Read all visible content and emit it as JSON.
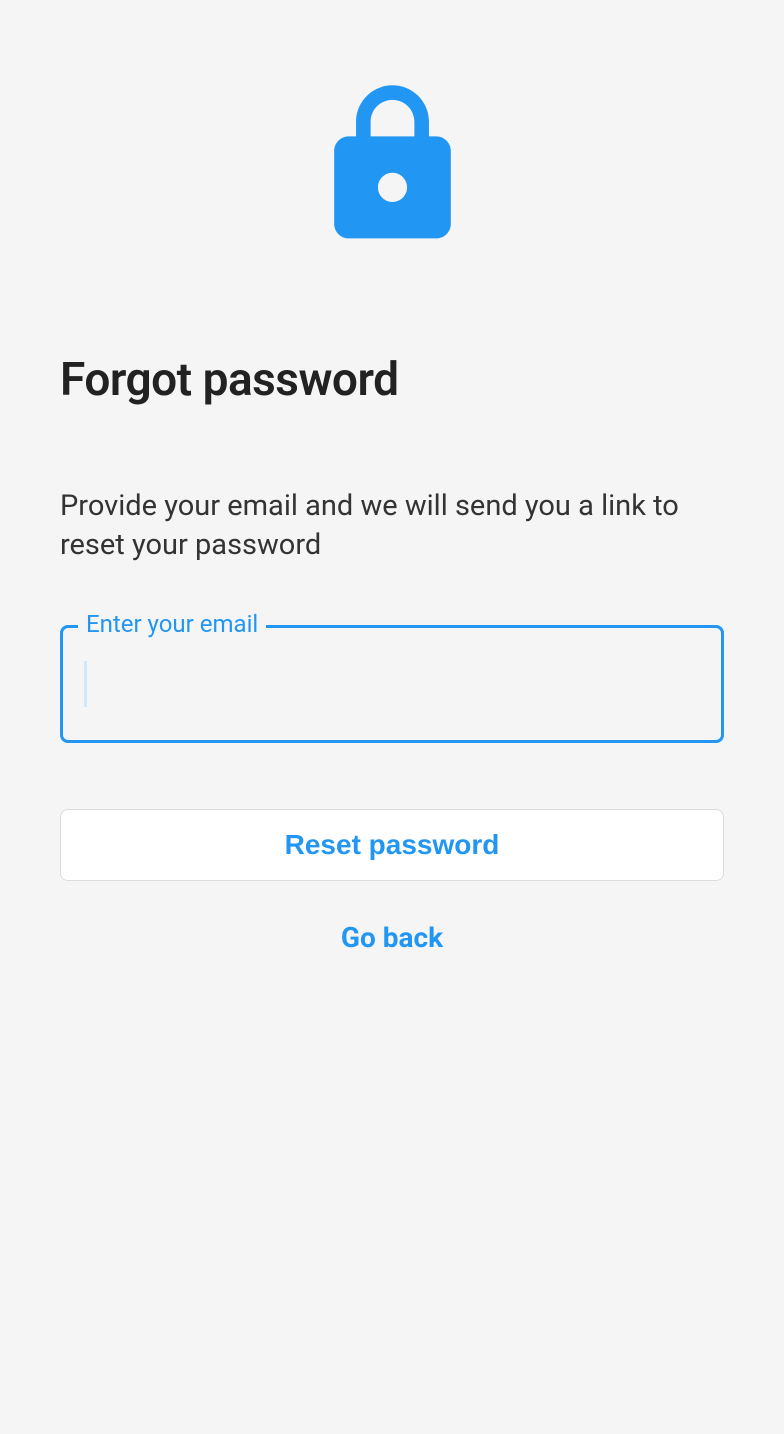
{
  "colors": {
    "accent": "#2196f3",
    "background": "#f5f5f5"
  },
  "icon": "lock-icon",
  "title": "Forgot password",
  "description": "Provide your email and we will send you a link to reset your password",
  "email_field": {
    "label": "Enter your email",
    "value": ""
  },
  "reset_button_label": "Reset password",
  "go_back_label": "Go back"
}
